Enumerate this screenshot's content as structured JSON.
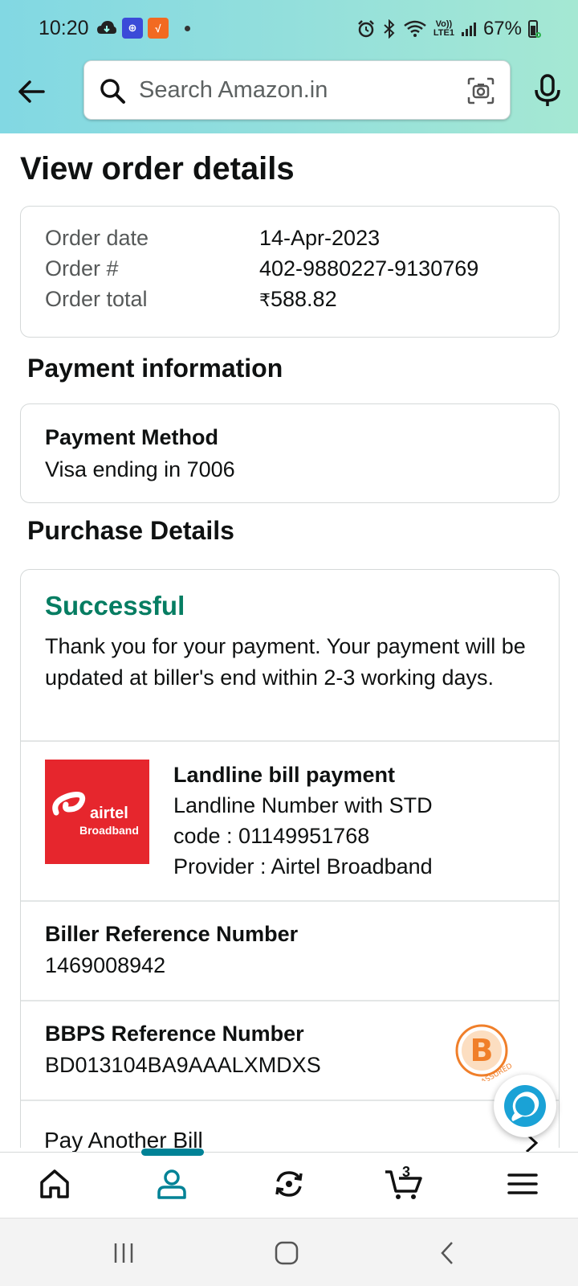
{
  "status_bar": {
    "time": "10:20",
    "battery": "67%",
    "lte_top": "Vo))",
    "lte_bottom": "LTE1"
  },
  "search": {
    "placeholder": "Search Amazon.in"
  },
  "page": {
    "title": "View order details"
  },
  "order": {
    "date_label": "Order date",
    "date_value": "14-Apr-2023",
    "number_label": "Order #",
    "number_value": "402-9880227-9130769",
    "total_label": "Order total",
    "total_currency": "₹",
    "total_value": "588.82"
  },
  "payment": {
    "section_title": "Payment information",
    "method_label": "Payment Method",
    "method_value": "Visa ending in 7006"
  },
  "purchase": {
    "section_title": "Purchase Details",
    "status": "Successful",
    "status_message": "Thank you for your payment. Your payment will be updated at biller's end within 2-3 working days.",
    "bill_title": "Landline bill payment",
    "bill_line1": "Landline Number with STD",
    "bill_line2": "code : 01149951768",
    "bill_line3": "Provider : Airtel Broadband",
    "logo_name": "airtel",
    "logo_sub": "Broadband",
    "biller_ref_label": "Biller Reference Number",
    "biller_ref_value": "1469008942",
    "bbps_ref_label": "BBPS Reference Number",
    "bbps_ref_value": "BD013104BA9AAALXMDXS",
    "assured_text": "ASSURED",
    "assured_letter": "B",
    "pay_another": "Pay Another Bill"
  },
  "bottom_nav": {
    "cart_count": "3",
    "items": [
      "home-icon",
      "profile-icon",
      "returns-icon",
      "cart-icon",
      "menu-icon"
    ]
  },
  "colors": {
    "success": "#067d62",
    "accent": "#008296",
    "airtel_red": "#e6262d",
    "header_gradient_start": "#82d8e3",
    "header_gradient_end": "#a5e8d3"
  }
}
